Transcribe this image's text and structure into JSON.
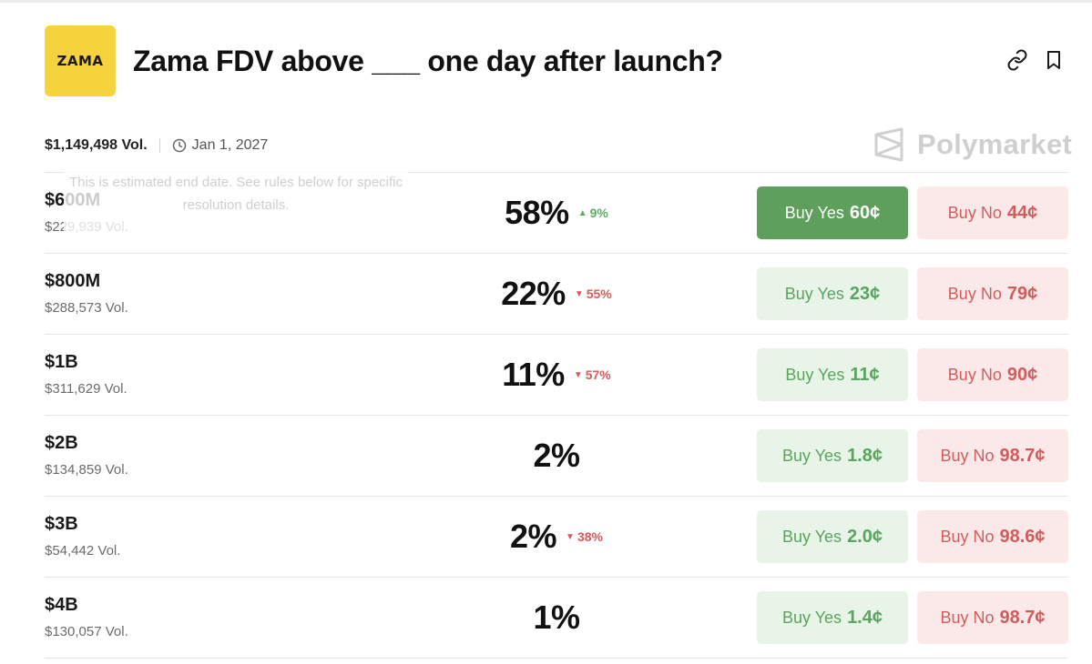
{
  "market": {
    "logo_text": "ZAMA",
    "title": "Zama FDV above ___ one day after launch?",
    "volume": "$1,149,498 Vol.",
    "end_date": "Jan 1, 2027",
    "tooltip": "This is estimated end date. See rules below for specific resolution details.",
    "brand": "Polymarket"
  },
  "icons": {
    "link": "link-icon",
    "bookmark": "bookmark-icon",
    "clock": "clock-icon",
    "brand_mark": "polymarket-logo-icon"
  },
  "colors": {
    "logo_bg": "#f6d23d",
    "yes_active": "#5e9f5c",
    "yes_bg": "#e8f4e8",
    "yes_text": "#5aa45f",
    "no_bg": "#fbe9e9",
    "no_text": "#d25c5c",
    "up": "#5aae62",
    "down": "#d85a5a"
  },
  "outcomes": [
    {
      "label": "$600M",
      "volume": "$229,939 Vol.",
      "pct": "58%",
      "delta_dir": "up",
      "delta": "9%",
      "yes_label": "Buy Yes",
      "yes_price": "60¢",
      "no_label": "Buy No",
      "no_price": "44¢",
      "active": true
    },
    {
      "label": "$800M",
      "volume": "$288,573 Vol.",
      "pct": "22%",
      "delta_dir": "down",
      "delta": "55%",
      "yes_label": "Buy Yes",
      "yes_price": "23¢",
      "no_label": "Buy No",
      "no_price": "79¢",
      "active": false
    },
    {
      "label": "$1B",
      "volume": "$311,629 Vol.",
      "pct": "11%",
      "delta_dir": "down",
      "delta": "57%",
      "yes_label": "Buy Yes",
      "yes_price": "11¢",
      "no_label": "Buy No",
      "no_price": "90¢",
      "active": false
    },
    {
      "label": "$2B",
      "volume": "$134,859 Vol.",
      "pct": "2%",
      "delta_dir": "",
      "delta": "",
      "yes_label": "Buy Yes",
      "yes_price": "1.8¢",
      "no_label": "Buy No",
      "no_price": "98.7¢",
      "active": false
    },
    {
      "label": "$3B",
      "volume": "$54,442 Vol.",
      "pct": "2%",
      "delta_dir": "down",
      "delta": "38%",
      "yes_label": "Buy Yes",
      "yes_price": "2.0¢",
      "no_label": "Buy No",
      "no_price": "98.6¢",
      "active": false
    },
    {
      "label": "$4B",
      "volume": "$130,057 Vol.",
      "pct": "1%",
      "delta_dir": "",
      "delta": "",
      "yes_label": "Buy Yes",
      "yes_price": "1.4¢",
      "no_label": "Buy No",
      "no_price": "98.7¢",
      "active": false
    }
  ]
}
